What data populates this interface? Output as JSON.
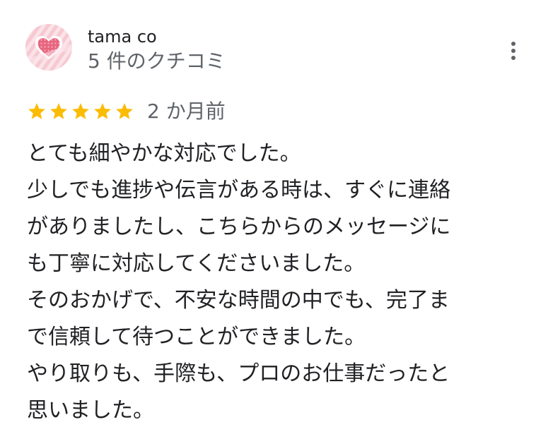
{
  "review": {
    "author": "tama co",
    "review_count": "5 件のクチコミ",
    "rating": 5,
    "rating_max": 5,
    "date": "2 か月前",
    "star_color": "#fbbc04",
    "lines": [
      "とても細やかな対応でした。",
      "少しでも進捗や伝言がある時は、すぐに連絡",
      "がありましたし、こちらからのメッセージに",
      "も丁寧に対応してくださいました。",
      "そのおかげで、不安な時間の中でも、完了ま",
      "で信頼して待つことができました。",
      "やり取りも、手際も、プロのお仕事だったと",
      "思いました。"
    ]
  },
  "icons": {
    "avatar": "pink-heart-avatar-icon",
    "more": "more-vertical-icon",
    "star": "star-icon"
  }
}
